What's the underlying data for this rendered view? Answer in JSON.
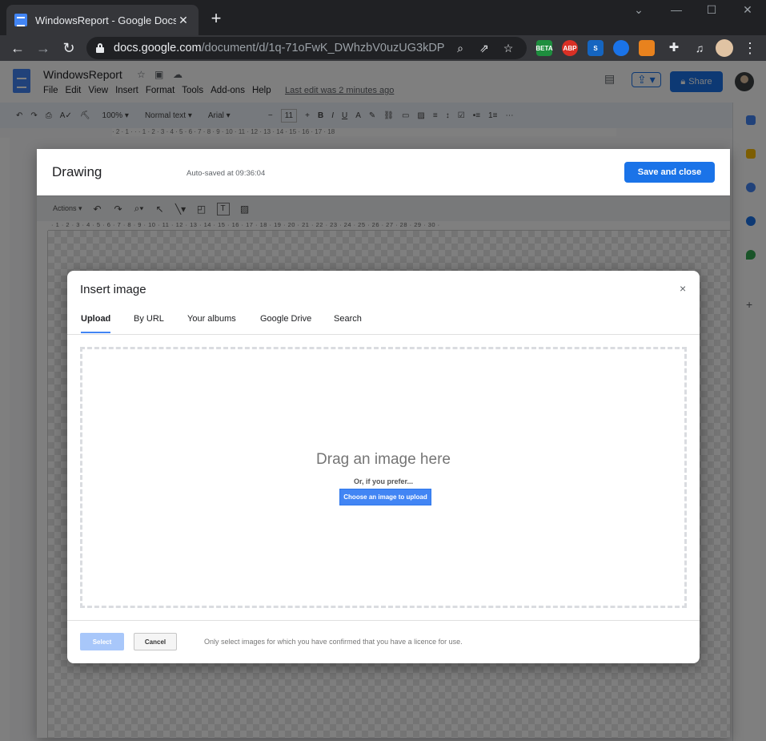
{
  "browser": {
    "tab_title": "WindowsReport - Google Docs",
    "url_host": "docs.google.com",
    "url_path": "/document/d/1q-71oFwK_DWhzbV0uzUG3kDP0...",
    "extensions": [
      {
        "name": "beta-extension-icon",
        "label": "BETA",
        "color": "#1e8e3e"
      },
      {
        "name": "adblock-icon",
        "label": "ABP",
        "color": "#d93025"
      },
      {
        "name": "s-extension-icon",
        "label": "S",
        "color": "#1565c0"
      },
      {
        "name": "robot-extension-icon",
        "label": "",
        "color": "#1a73e8"
      },
      {
        "name": "metamask-icon",
        "label": "",
        "color": "#e8821e"
      }
    ]
  },
  "docs": {
    "title": "WindowsReport",
    "menu": [
      "File",
      "Edit",
      "View",
      "Insert",
      "Format",
      "Tools",
      "Add-ons",
      "Help"
    ],
    "last_edit": "Last edit was 2 minutes ago",
    "share_label": "Share",
    "toolbar": {
      "zoom": "100%",
      "style": "Normal text",
      "font": "Arial",
      "size": "11"
    },
    "ruler": "· 2 · 1 · · · 1 · 2 · 3 · 4 · 5 · 6 · 7 · 8 · 9 · 10 · 11 · 12 · 13 · 14 · 15 · 16 · 17 · 18"
  },
  "drawing": {
    "title": "Drawing",
    "autosave": "Auto-saved at 09:36:04",
    "save_close_label": "Save and close",
    "actions_label": "Actions",
    "ruler": "· 1 · 2 · 3 · 4 · 5 · 6 · 7 · 8 · 9 · 10 · 11 · 12 · 13 · 14 · 15 · 16 · 17 · 18 · 19 · 20 · 21 · 22 · 23 · 24 · 25 · 26 · 27 · 28 · 29 · 30 ·"
  },
  "insert_image": {
    "title": "Insert image",
    "close_glyph": "×",
    "tabs": [
      "Upload",
      "By URL",
      "Your albums",
      "Google Drive",
      "Search"
    ],
    "active_tab": "Upload",
    "drag_text": "Drag an image here",
    "prefer_text": "Or, if you prefer...",
    "choose_label": "Choose an image to upload",
    "select_label": "Select",
    "cancel_label": "Cancel",
    "licence_text": "Only select images for which you have confirmed that you have a licence for use."
  }
}
